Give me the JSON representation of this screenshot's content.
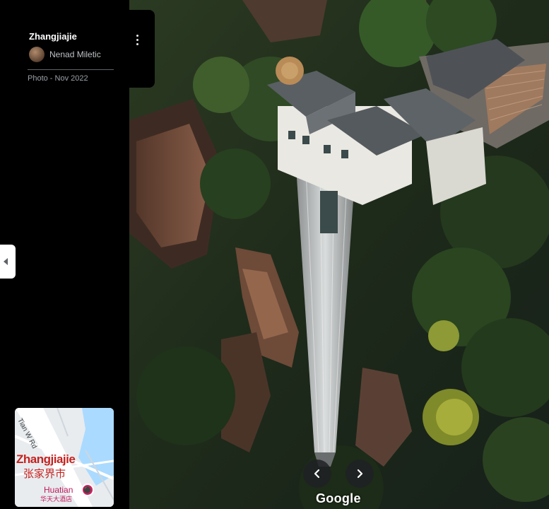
{
  "info_card": {
    "title": "Zhangjiajie",
    "author": "Nenad Miletic",
    "photo_date": "Photo - Nov 2022",
    "more_options_icon": "kebab-vertical-icon"
  },
  "side_panel": {
    "collapse_icon": "caret-left-icon"
  },
  "minimap": {
    "road_label": "Tian W Rd",
    "city_label": "Zhangjiajie",
    "city_label_cn": "张家界市",
    "hotel_label": "Huatian",
    "hotel_label_cn": "华天大酒店",
    "hotel_icon": "hotel-bed-icon",
    "pegman_icon": "pegman-icon",
    "colors": {
      "water": "#aadaff",
      "land": "#e8ecef",
      "city": "#c5221f",
      "hotel": "#d81b60"
    }
  },
  "navigation": {
    "prev_icon": "chevron-left-icon",
    "next_icon": "chevron-right-icon"
  },
  "branding": {
    "logo_text": "Google"
  },
  "photo": {
    "subject": "aerial-photo-bailong-elevator"
  }
}
